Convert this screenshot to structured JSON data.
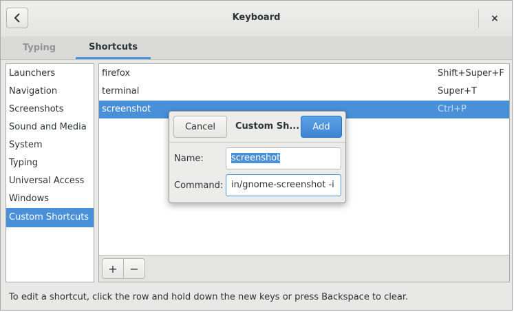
{
  "window": {
    "title": "Keyboard",
    "back_icon": "chevron-left-icon",
    "close_glyph": "×"
  },
  "tabs": [
    {
      "label": "Typing",
      "active": false
    },
    {
      "label": "Shortcuts",
      "active": true
    }
  ],
  "sidebar": {
    "items": [
      {
        "label": "Launchers"
      },
      {
        "label": "Navigation"
      },
      {
        "label": "Screenshots"
      },
      {
        "label": "Sound and Media"
      },
      {
        "label": "System"
      },
      {
        "label": "Typing"
      },
      {
        "label": "Universal Access"
      },
      {
        "label": "Windows"
      },
      {
        "label": "Custom Shortcuts",
        "selected": true
      }
    ]
  },
  "shortcuts": [
    {
      "name": "firefox",
      "accel": "Shift+Super+F"
    },
    {
      "name": "terminal",
      "accel": "Super+T"
    },
    {
      "name": "screenshot",
      "accel": "Ctrl+P",
      "selected": true
    }
  ],
  "toolbar": {
    "add": "+",
    "remove": "−"
  },
  "hint": "To edit a shortcut, click the row and hold down the new keys or press Backspace to clear.",
  "dialog": {
    "cancel": "Cancel",
    "title": "Custom Sh...",
    "add": "Add",
    "name_label": "Name:",
    "name_value": "screenshot",
    "command_label": "Command:",
    "command_value": "in/gnome-screenshot -i"
  },
  "colors": {
    "accent": "#4a90d9",
    "background": "#e8e8e7"
  }
}
